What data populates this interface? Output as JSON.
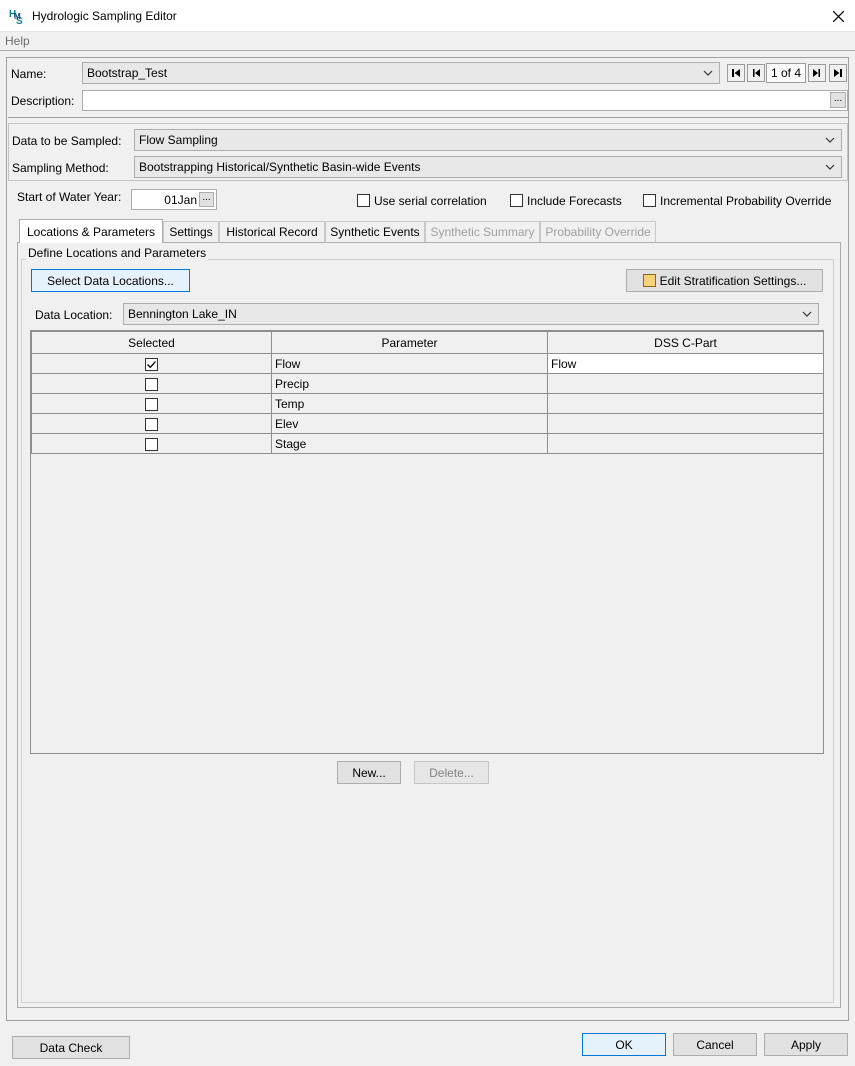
{
  "window": {
    "title": "Hydrologic Sampling Editor",
    "menu_help": "Help"
  },
  "name_row": {
    "label": "Name:",
    "value": "Bootstrap_Test",
    "nav_position": "1 of 4"
  },
  "description_row": {
    "label": "Description:",
    "value": "",
    "browse_label": "..."
  },
  "data_to_sample": {
    "label": "Data to be Sampled:",
    "value": "Flow Sampling"
  },
  "sampling_method": {
    "label": "Sampling Method:",
    "value": "Bootstrapping Historical/Synthetic Basin-wide Events"
  },
  "water_year": {
    "label": "Start of Water Year:",
    "value": "01Jan",
    "browse_label": "..."
  },
  "options": {
    "serial_correlation": {
      "label": "Use serial correlation",
      "checked": false
    },
    "include_forecasts": {
      "label": "Include Forecasts",
      "checked": false
    },
    "incremental_override": {
      "label": "Incremental Probability Override",
      "checked": false
    }
  },
  "tabs": [
    {
      "label": "Locations & Parameters",
      "active": true,
      "enabled": true
    },
    {
      "label": "Settings",
      "active": false,
      "enabled": true
    },
    {
      "label": "Historical Record",
      "active": false,
      "enabled": true
    },
    {
      "label": "Synthetic Events",
      "active": false,
      "enabled": true
    },
    {
      "label": "Synthetic Summary",
      "active": false,
      "enabled": false
    },
    {
      "label": "Probability Override",
      "active": false,
      "enabled": false
    }
  ],
  "locations_panel": {
    "group_title": "Define Locations and Parameters",
    "select_locations_label": "Select Data Locations...",
    "edit_stratification_label": "Edit Stratification Settings...",
    "data_location_label": "Data Location:",
    "data_location_value": "Bennington Lake_IN",
    "table": {
      "headers": [
        "Selected",
        "Parameter",
        "DSS C-Part"
      ],
      "rows": [
        {
          "selected": true,
          "parameter": "Flow",
          "dss_cpart": "Flow"
        },
        {
          "selected": false,
          "parameter": "Precip",
          "dss_cpart": ""
        },
        {
          "selected": false,
          "parameter": "Temp",
          "dss_cpart": ""
        },
        {
          "selected": false,
          "parameter": "Elev",
          "dss_cpart": ""
        },
        {
          "selected": false,
          "parameter": "Stage",
          "dss_cpart": ""
        }
      ]
    },
    "new_label": "New...",
    "delete_label": "Delete..."
  },
  "footer": {
    "data_check": "Data Check",
    "ok": "OK",
    "cancel": "Cancel",
    "apply": "Apply"
  }
}
